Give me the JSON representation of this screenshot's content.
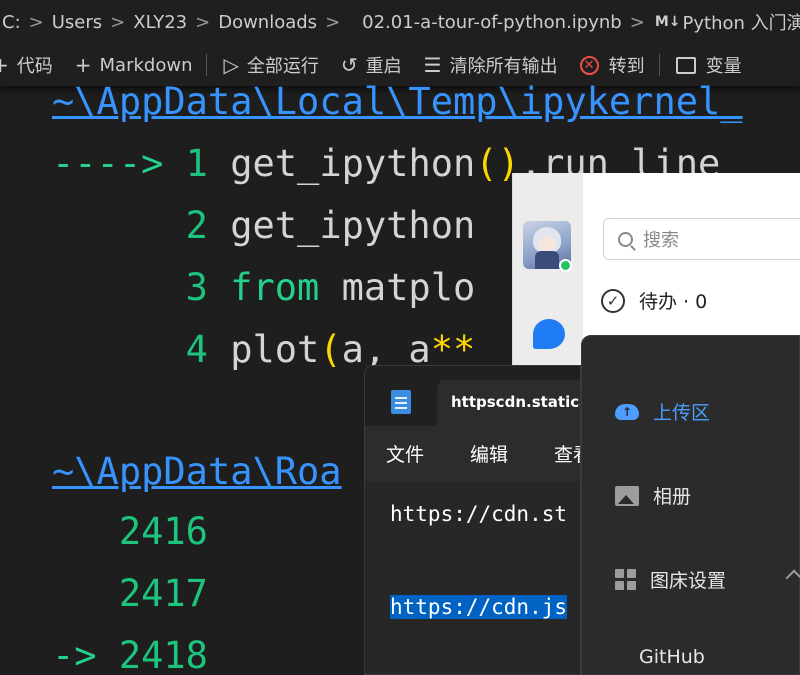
{
  "breadcrumb": {
    "parts": [
      "C:",
      "Users",
      "XLY23",
      "Downloads",
      "02.01-a-tour-of-python.ipynb"
    ],
    "md_prefix": "M↓",
    "section": "Python 入门演示"
  },
  "toolbar": {
    "code_label": "代码",
    "markdown_label": "Markdown",
    "run_all_label": "全部运行",
    "restart_label": "重启",
    "clear_outputs_label": "清除所有输出",
    "goto_label": "转到",
    "variables_label": "变量"
  },
  "output": {
    "path1": "~\\AppData\\Local\\Temp\\ipykernel_",
    "arrow1": "---->",
    "lines": [
      {
        "num": "1",
        "text": "get_ipython().run_line"
      },
      {
        "num": "2",
        "text": "get_ipython"
      },
      {
        "num": "3",
        "text": "from matplo"
      },
      {
        "num": "4",
        "text": "plot(a, a**"
      }
    ],
    "path2": "~\\AppData\\Roa",
    "lines2": [
      "2416",
      "2417",
      "2418"
    ],
    "arrow2": "->"
  },
  "chat": {
    "search_placeholder": "搜索",
    "todo_label": "待办 · 0"
  },
  "upload": {
    "items": [
      "上传区",
      "相册",
      "图床设置",
      "GitHub"
    ]
  },
  "notepad": {
    "tab_title": "httpscdn.statica",
    "menu": [
      "文件",
      "编辑",
      "查看"
    ],
    "line1": "https://cdn.st",
    "line2": "https://cdn.js"
  },
  "colors": {
    "editor_bg": "#1e1e1e",
    "link": "#3794ff",
    "green": "#23d18b",
    "paren": "#ffd700",
    "stop_red": "#f14c4c",
    "upload_active": "#4c9dff",
    "selection": "#0063c4"
  },
  "icons": [
    "notebook-icon",
    "plus-icon",
    "run-all-icon",
    "restart-icon",
    "clear-outputs-icon",
    "stop-icon",
    "variables-icon",
    "search-icon",
    "todo-check-icon",
    "cloud-upload-icon",
    "album-icon",
    "settings-grid-icon",
    "notepad-icon",
    "chat-bubble-icon"
  ]
}
